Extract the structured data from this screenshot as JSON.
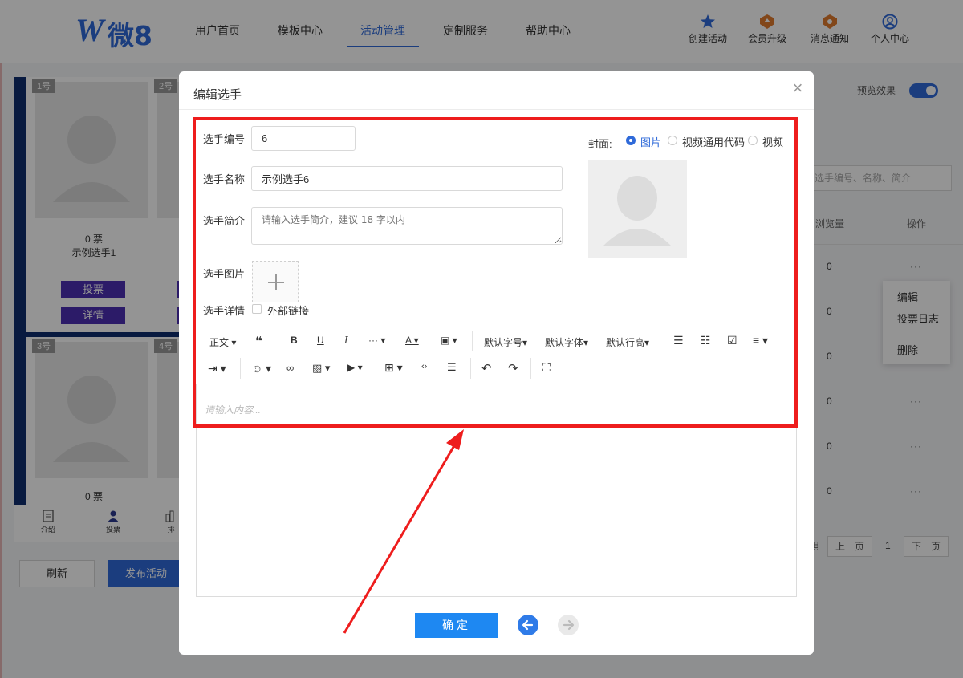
{
  "logo": {
    "text": "微8"
  },
  "nav": {
    "items": [
      "用户首页",
      "模板中心",
      "活动管理",
      "定制服务",
      "帮助中心"
    ],
    "active": "活动管理"
  },
  "right_nav": [
    {
      "label": "创建活动",
      "icon": "star-badge-icon"
    },
    {
      "label": "会员升级",
      "icon": "upgrade-badge-icon"
    },
    {
      "label": "消息通知",
      "icon": "notification-badge-icon"
    },
    {
      "label": "个人中心",
      "icon": "user-circle-icon"
    }
  ],
  "background": {
    "cards": [
      {
        "num": "1号",
        "votes": "0 票",
        "name": "示例选手1",
        "vote_btn": "投票",
        "detail_btn": "详情"
      },
      {
        "num": "2号"
      },
      {
        "num": "3号",
        "votes": "0 票"
      },
      {
        "num": "4号"
      }
    ],
    "phone_tabs": [
      {
        "label": "介绍",
        "icon": "doc-icon"
      },
      {
        "label": "投票",
        "icon": "person-icon"
      },
      {
        "label": "排",
        "icon": "rank-icon"
      }
    ],
    "buttons": {
      "refresh": "刷新",
      "publish": "发布活动"
    },
    "preview_label": "预览效果",
    "search_placeholder": "选手编号、名称、简介",
    "table_headers": {
      "views": "浏览量",
      "ops": "操作"
    },
    "rows": [
      "0",
      "0",
      "0",
      "0",
      "0",
      "0"
    ],
    "row_dots": "···",
    "context_menu": [
      "编辑",
      "投票日志",
      "删除"
    ],
    "pagination": {
      "prev": "上一页",
      "page": "1",
      "next": "下一页",
      "partial": "共"
    }
  },
  "modal": {
    "title": "编辑选手",
    "close": "×",
    "fields": {
      "number_label": "选手编号",
      "number_value": "6",
      "name_label": "选手名称",
      "name_value": "示例选手6",
      "intro_label": "选手简介",
      "intro_placeholder": "请输入选手简介，建议 18 字以内",
      "image_label": "选手图片",
      "detail_label": "选手详情",
      "external_link_label": "外部链接"
    },
    "cover": {
      "label": "封面:",
      "options": [
        "图片",
        "视频通用代码",
        "视频"
      ],
      "selected": "图片"
    },
    "toolbar": {
      "row1": [
        "正文",
        "默认字号",
        "默认字体",
        "默认行高"
      ],
      "icons_row1": [
        "quote-icon",
        "bold-icon",
        "underline-icon",
        "italic-icon",
        "more-icon",
        "font-color-icon",
        "bg-color-icon",
        "bullet-list-icon",
        "number-list-icon",
        "todo-icon",
        "align-icon"
      ],
      "icons_row2": [
        "indent-icon",
        "emoji-icon",
        "link-icon",
        "image-icon",
        "video-icon",
        "table-icon",
        "code-icon",
        "divider-icon",
        "undo-icon",
        "redo-icon",
        "fullscreen-icon"
      ]
    },
    "editor_placeholder": "请输入内容...",
    "confirm": "确定"
  },
  "colors": {
    "accent": "#2f6ad9",
    "highlight": "#ee1d1d",
    "vote_btn": "#4c2fb3",
    "confirm": "#1e88f2"
  }
}
